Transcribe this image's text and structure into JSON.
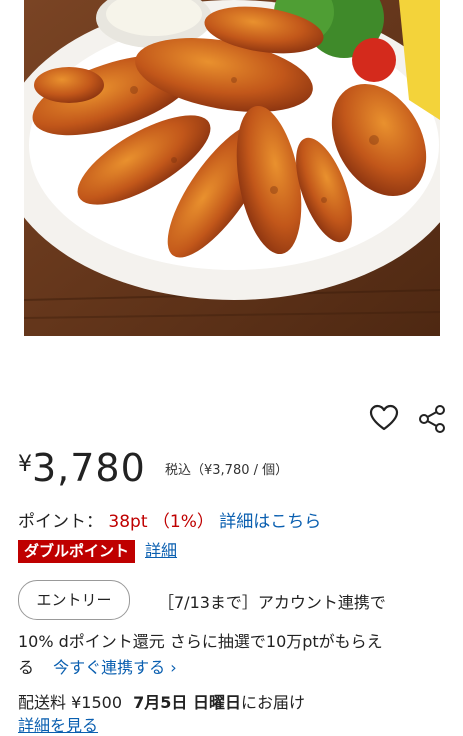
{
  "product_image": {
    "icon": "fried-chicken-wings-photo"
  },
  "actions": {
    "favorite_icon": "heart-icon",
    "share_icon": "share-icon"
  },
  "price": {
    "currency": "¥",
    "amount": "3,780",
    "tax_note": "税込（¥3,780 / 個）"
  },
  "points": {
    "label": "ポイント：",
    "value": "38pt",
    "rate": "（1%）",
    "detail_link": "詳細はこちら"
  },
  "double_points": {
    "badge": "ダブルポイント",
    "link": "詳細"
  },
  "campaign": {
    "entry_button": "エントリー",
    "line1": "［7/13まで］アカウント連携で",
    "line2": "10% dポイント還元 さらに抽選で10万ptがもらえ",
    "line3_prefix": "る",
    "line3_link": "今すぐ連携する ›"
  },
  "shipping": {
    "label": "配送料",
    "fee": "¥1500",
    "date": "7月5日 日曜日",
    "suffix": "にお届け",
    "detail_link": "詳細を見る"
  },
  "colors": {
    "accent_red": "#bf0000",
    "link_blue": "#0a5fb0"
  }
}
